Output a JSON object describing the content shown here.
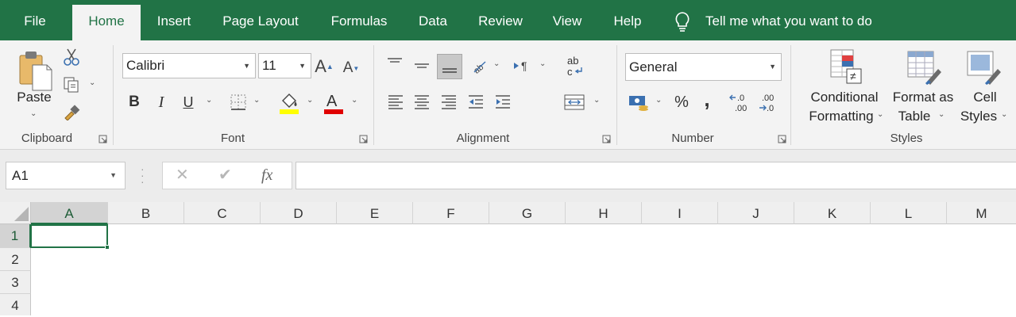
{
  "tabs": [
    "File",
    "Home",
    "Insert",
    "Page Layout",
    "Formulas",
    "Data",
    "Review",
    "View",
    "Help"
  ],
  "active_tab": "Home",
  "tell_me": "Tell me what you want to do",
  "clipboard": {
    "paste": "Paste",
    "group": "Clipboard"
  },
  "font": {
    "name": "Calibri",
    "size": "11",
    "bold": "B",
    "italic": "I",
    "underline": "U",
    "group": "Font",
    "highlight_color": "#ffff00",
    "font_color": "#e00000"
  },
  "alignment": {
    "group": "Alignment"
  },
  "number": {
    "format": "General",
    "percent": "%",
    "comma": ",",
    "group": "Number"
  },
  "styles": {
    "conditional": [
      "Conditional",
      "Formatting"
    ],
    "format_table": [
      "Format as",
      "Table"
    ],
    "cell_styles": [
      "Cell",
      "Styles"
    ],
    "group": "Styles"
  },
  "formula_bar": {
    "name_box": "A1",
    "cancel": "✕",
    "enter": "✔",
    "fx": "fx",
    "content": ""
  },
  "columns": [
    "A",
    "B",
    "C",
    "D",
    "E",
    "F",
    "G",
    "H",
    "I",
    "J",
    "K",
    "L",
    "M"
  ],
  "rows": [
    "1",
    "2",
    "3",
    "4"
  ],
  "selected_cell": "A1",
  "accent_color": "#217346"
}
